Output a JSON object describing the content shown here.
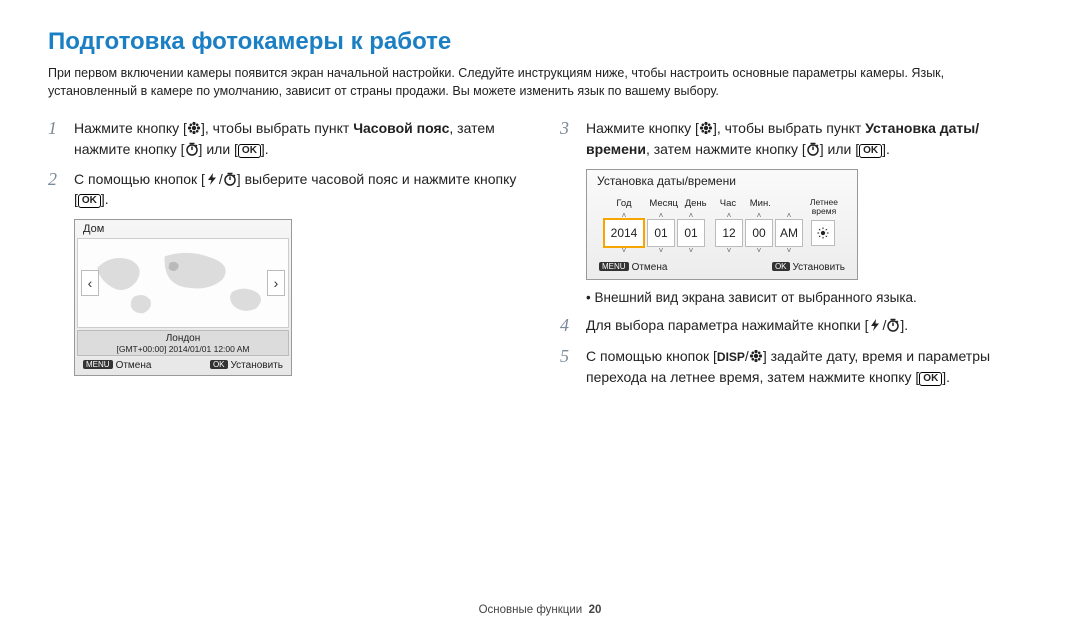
{
  "title": "Подготовка фотокамеры к работе",
  "intro": "При первом включении камеры появится экран начальной настройки. Следуйте инструкциям ниже, чтобы настроить основные параметры камеры. Язык, установленный в камере по умолчанию, зависит от страны продажи. Вы можете изменить язык по вашему выбору.",
  "steps": {
    "s1_a": "Нажмите кнопку [",
    "s1_b": "], чтобы выбрать пункт ",
    "s1_bold": "Часовой пояс",
    "s1_c": ", затем нажмите кнопку [",
    "s1_d": "] или [",
    "s1_e": "].",
    "s2_a": "С помощью кнопок [",
    "s2_b": "/",
    "s2_c": "] выберите часовой пояс и нажмите кнопку [",
    "s2_d": "].",
    "s3_a": "Нажмите кнопку [",
    "s3_b": "], чтобы выбрать пункт ",
    "s3_bold": "Установка даты/времени",
    "s3_c": ", затем нажмите кнопку [",
    "s3_d": "] или [",
    "s3_e": "].",
    "note": "Внешний вид экрана зависит от выбранного языка.",
    "s4_a": "Для выбора параметра нажимайте кнопки [",
    "s4_b": "/",
    "s4_c": "].",
    "s5_a": "С помощью кнопок [",
    "s5_disp": "DISP",
    "s5_b": "/",
    "s5_c": "] задайте дату, время и параметры перехода на летнее время, затем нажмите кнопку [",
    "s5_d": "]."
  },
  "ok_label": "OK",
  "screenshot1": {
    "header": "Дом",
    "city": "Лондон",
    "gmt": "[GMT+00:00] 2014/01/01  12:00 AM",
    "menu_badge": "MENU",
    "cancel": "Отмена",
    "ok_badge": "OK",
    "set": "Установить"
  },
  "screenshot2": {
    "header": "Установка даты/времени",
    "col_year": "Год",
    "col_month": "Месяц",
    "col_day": "День",
    "col_hour": "Час",
    "col_min": "Мин.",
    "col_dst": "Летнее время",
    "val_year": "2014",
    "val_month": "01",
    "val_day": "01",
    "val_hour": "12",
    "val_min": "00",
    "val_ampm": "AM",
    "menu_badge": "MENU",
    "cancel": "Отмена",
    "ok_badge": "OK",
    "set": "Установить"
  },
  "footer_section": "Основные функции",
  "footer_page": "20"
}
